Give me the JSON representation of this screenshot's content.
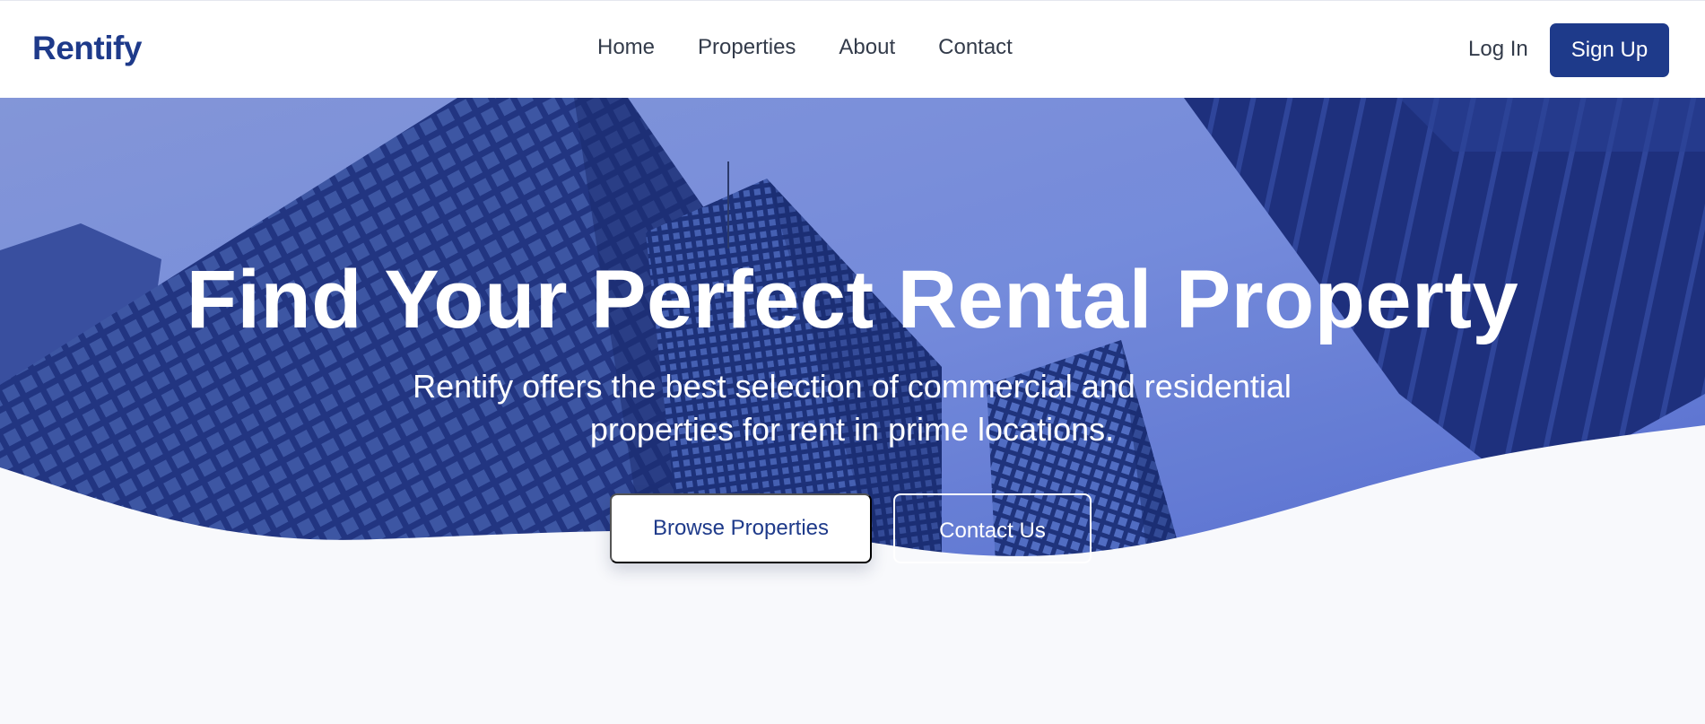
{
  "brand": {
    "name": "Rentify",
    "color": "#1e3a8a"
  },
  "nav": {
    "items": [
      {
        "label": "Home"
      },
      {
        "label": "Properties"
      },
      {
        "label": "About"
      },
      {
        "label": "Contact"
      }
    ],
    "login_label": "Log In",
    "signup_label": "Sign Up"
  },
  "hero": {
    "title": "Find Your Perfect Rental Property",
    "subtitle": "Rentify offers the best selection of commercial and residential properties for rent in prime locations.",
    "primary_cta": "Browse Properties",
    "secondary_cta": "Contact Us",
    "image": "skyscrapers-icon",
    "overlay_color": "#3d56c7"
  },
  "colors": {
    "accent": "#1e3a8a",
    "page_bg": "#f8f9fc",
    "text": "#333b4a"
  }
}
